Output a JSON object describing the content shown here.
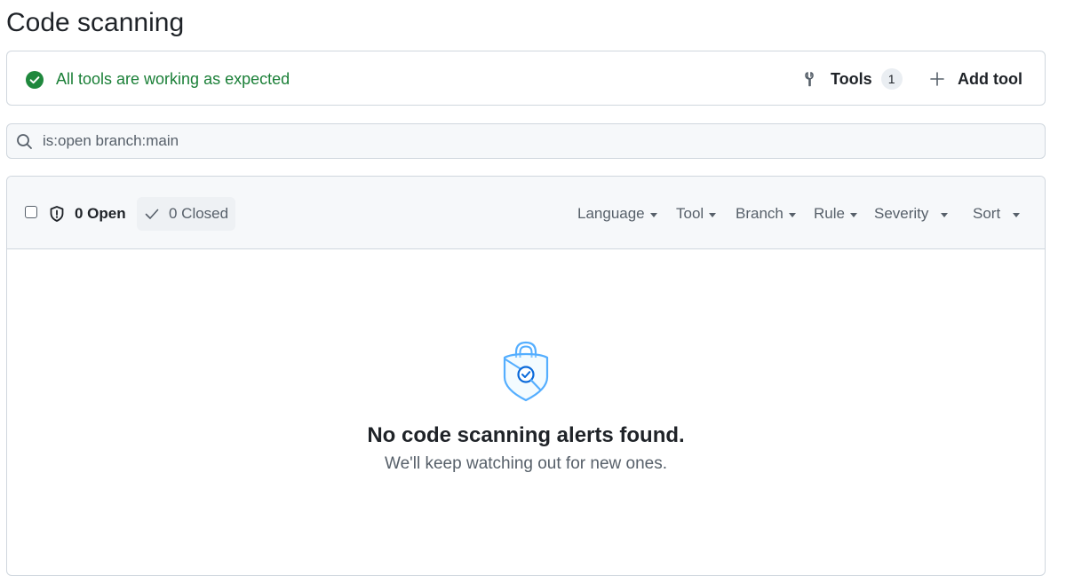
{
  "page": {
    "title": "Code scanning"
  },
  "status": {
    "message": "All tools are working as expected",
    "tools_label": "Tools",
    "tools_count": "1",
    "add_tool_label": "Add tool"
  },
  "search": {
    "value": "is:open branch:main"
  },
  "results": {
    "open_label": "0 Open",
    "closed_label": "0 Closed",
    "filters": [
      "Language",
      "Tool",
      "Branch",
      "Rule",
      "Severity",
      "Sort"
    ]
  },
  "empty_state": {
    "heading": "No code scanning alerts found.",
    "subtext": "We'll keep watching out for new ones."
  },
  "colors": {
    "success": "#1a7f37",
    "accent_blue": "#54aeff",
    "border": "#d0d7de"
  },
  "icons": {
    "status": "check-circle-fill-icon",
    "tools": "tools-icon",
    "add": "plus-icon",
    "search": "search-icon",
    "open": "shield-icon",
    "closed": "check-icon",
    "empty": "shield-lock-search-icon"
  }
}
